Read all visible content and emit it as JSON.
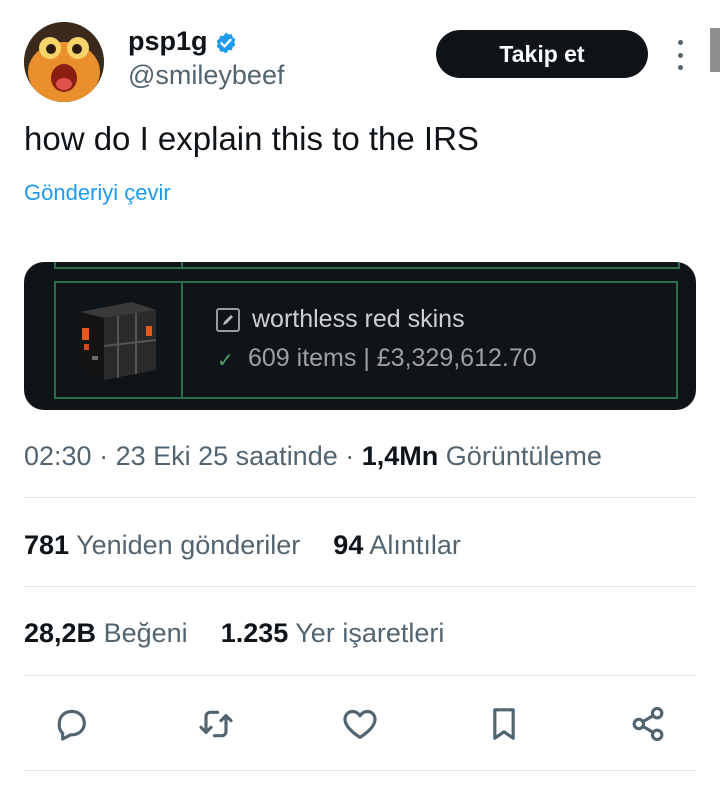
{
  "user": {
    "display_name": "psp1g",
    "handle": "@smileybeef",
    "verified": true
  },
  "header": {
    "follow_label": "Takip et"
  },
  "tweet": {
    "text": "how do I explain this to the IRS",
    "translate_label": "Gönderiyi çevir"
  },
  "media": {
    "inventory_name": "worthless red skins",
    "inventory_stats": "609 items | £3,329,612.70"
  },
  "meta": {
    "time": "02:30",
    "date": "23 Eki 25 saatinde",
    "views_count": "1,4Mn",
    "views_label": "Görüntüleme"
  },
  "stats": {
    "retweets_count": "781",
    "retweets_label": "Yeniden gönderiler",
    "quotes_count": "94",
    "quotes_label": "Alıntılar",
    "likes_count": "28,2B",
    "likes_label": "Beğeni",
    "bookmarks_count": "1.235",
    "bookmarks_label": "Yer işaretleri"
  },
  "actions": [
    "reply-icon",
    "retweet-icon",
    "like-icon",
    "bookmark-icon",
    "share-icon"
  ],
  "colors": {
    "accent": "#1d9bf0",
    "text_primary": "#0f1419",
    "text_secondary": "#536471",
    "follow_bg": "#0f1419",
    "frame_green": "#2c6e4b"
  }
}
